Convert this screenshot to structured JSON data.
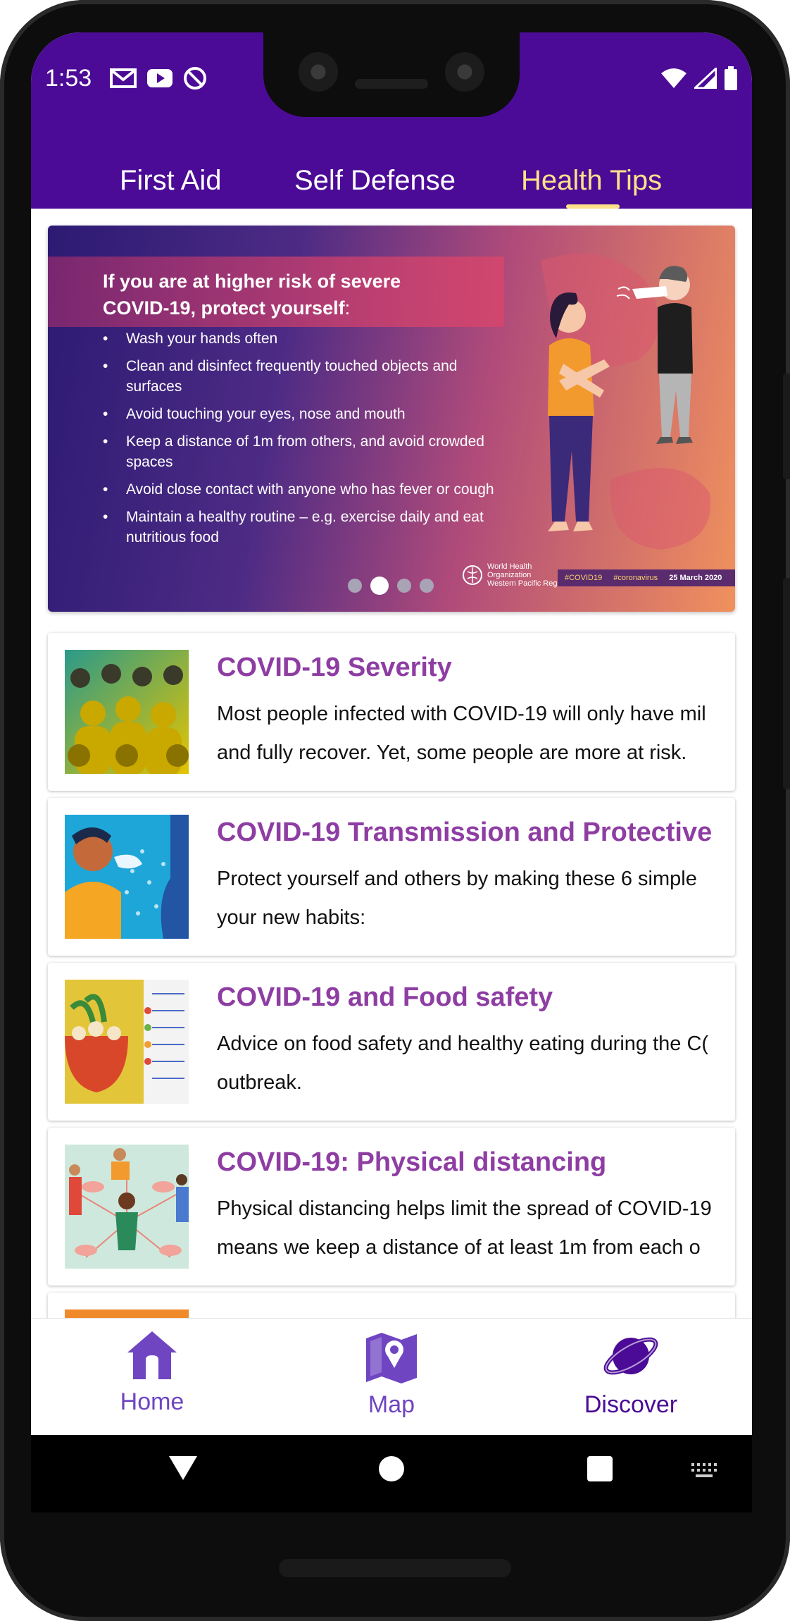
{
  "status": {
    "time": "1:53",
    "left_icons": [
      "gmail-icon",
      "youtube-icon",
      "do-not-disturb-icon"
    ],
    "right_icons": [
      "wifi-icon",
      "cellular-signal-icon",
      "battery-icon"
    ]
  },
  "tabs": [
    {
      "label": "First Aid",
      "active": false
    },
    {
      "label": "Self Defense",
      "active": false
    },
    {
      "label": "Health Tips",
      "active": true
    }
  ],
  "banner": {
    "title_line1": "If you are at higher risk of severe",
    "title_line2": "COVID-19, protect yourself",
    "title_suffix": ":",
    "items": [
      "Wash your hands often",
      "Clean and disinfect frequently touched objects and surfaces",
      "Avoid touching your eyes, nose and mouth",
      "Keep a distance of 1m from others, and avoid crowded spaces",
      "Avoid close contact with anyone who has fever or cough",
      "Maintain a healthy routine – e.g. exercise daily and eat nutritious food"
    ],
    "org_line1": "World Health",
    "org_line2": "Organization",
    "org_line3": "Western Pacific Region",
    "tag1": "#COVID19",
    "tag2": "#coronavirus",
    "date": "25 March 2020",
    "carousel_dots": 4,
    "active_dot": 2
  },
  "cards": [
    {
      "title": "COVID-19 Severity",
      "line1": "Most people infected with COVID-19 will only have mil",
      "line2": "and fully recover. Yet, some people are more at risk."
    },
    {
      "title": "COVID-19 Transmission and Protective",
      "line1": "Protect yourself and others by making these 6 simple",
      "line2": "your new habits:"
    },
    {
      "title": "COVID-19 and Food safety",
      "line1": "Advice on food safety and healthy eating during the C(",
      "line2": "outbreak."
    },
    {
      "title": "COVID-19: Physical distancing",
      "line1": "Physical distancing helps limit the spread of COVID-19",
      "line2": "means we keep a distance of at least 1m from each o"
    }
  ],
  "bottom_nav": [
    {
      "label": "Home",
      "icon": "home-icon"
    },
    {
      "label": "Map",
      "icon": "map-icon"
    },
    {
      "label": "Discover",
      "icon": "planet-icon",
      "active": true
    }
  ],
  "colors": {
    "app_bar": "#4b0b96",
    "active_tab": "#ffe08a",
    "card_title": "#8e3da3",
    "nav_inactive": "#6f45c2",
    "nav_active": "#4b0b96"
  }
}
